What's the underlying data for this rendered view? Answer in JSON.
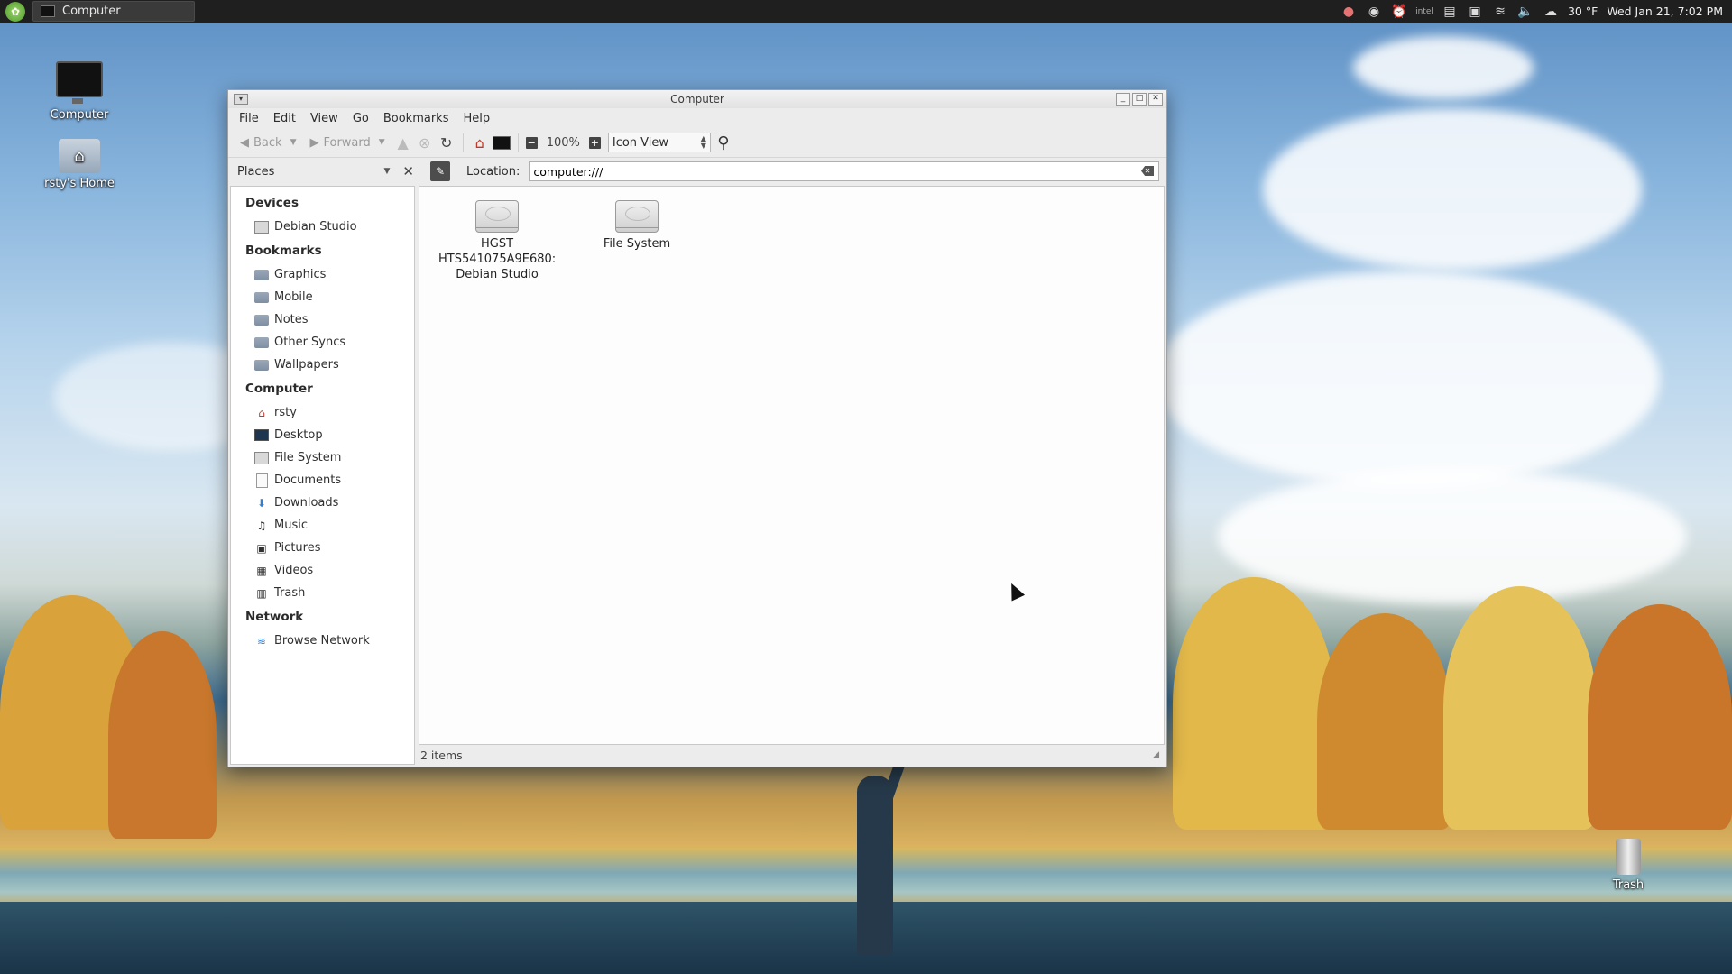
{
  "taskbar": {
    "window_button": "Computer",
    "weather": "30 °F",
    "clock": "Wed Jan 21,  7:02 PM"
  },
  "desktop": {
    "icons": {
      "computer": "Computer",
      "home": "rsty's Home",
      "trash": "Trash"
    }
  },
  "window": {
    "title": "Computer",
    "menu": [
      "File",
      "Edit",
      "View",
      "Go",
      "Bookmarks",
      "Help"
    ],
    "toolbar": {
      "back": "Back",
      "forward": "Forward",
      "zoom": "100%",
      "view_mode": "Icon View"
    },
    "places_label": "Places",
    "location_label": "Location:",
    "location_value": "computer:///",
    "sidebar": {
      "devices_head": "Devices",
      "devices": [
        "Debian Studio"
      ],
      "bookmarks_head": "Bookmarks",
      "bookmarks": [
        "Graphics",
        "Mobile",
        "Notes",
        "Other Syncs",
        "Wallpapers"
      ],
      "computer_head": "Computer",
      "computer": [
        "rsty",
        "Desktop",
        "File System",
        "Documents",
        "Downloads",
        "Music",
        "Pictures",
        "Videos",
        "Trash"
      ],
      "network_head": "Network",
      "network": [
        "Browse Network"
      ]
    },
    "files": [
      {
        "line1": "HGST",
        "line2": "HTS541075A9E680:",
        "line3": "Debian Studio"
      },
      {
        "line1": "File System",
        "line2": "",
        "line3": ""
      }
    ],
    "status": "2 items"
  },
  "colors": {
    "panel": "#1f1f1f",
    "window_bg": "#ececec",
    "content_bg": "#fdfdfd"
  }
}
